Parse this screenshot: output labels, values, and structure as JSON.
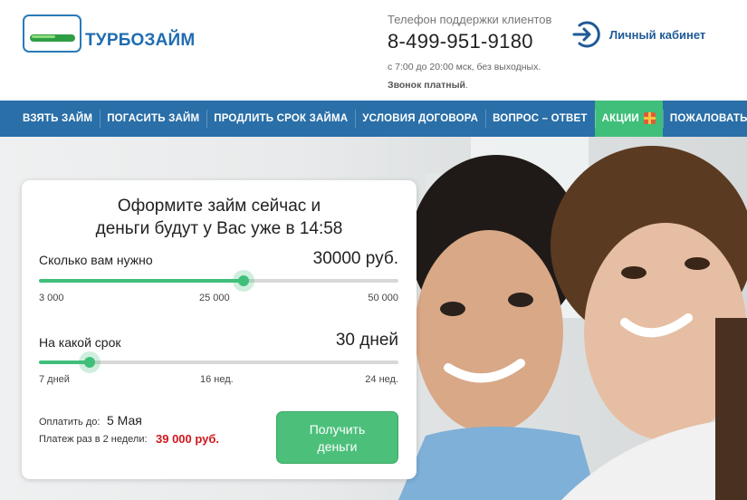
{
  "header": {
    "logo_text": "ТУРБОЗАЙМ",
    "support_label": "Телефон поддержки клиентов",
    "phone": "8-499-951-9180",
    "hours": "с 7:00 до 20:00 мск, без выходных.",
    "paid_strong": "Звонок платный",
    "paid_tail": ".",
    "account_label": "Личный кабинет",
    "account_icon": "login-arrow-icon"
  },
  "nav": {
    "items": [
      "ВЗЯТЬ ЗАЙМ",
      "ПОГАСИТЬ ЗАЙМ",
      "ПРОДЛИТЬ СРОК ЗАЙМА",
      "УСЛОВИЯ ДОГОВОРА",
      "ВОПРОС – ОТВЕТ",
      "АКЦИИ",
      "ПОЖАЛОВАТЬСЯ"
    ],
    "promo_icon": "gift-icon"
  },
  "form": {
    "title_line1": "Оформите займ сейчас и",
    "title_line2": "деньги будут у Вас уже в 14:58",
    "amount": {
      "label": "Сколько вам нужно",
      "value": "30000 руб.",
      "min_label": "3 000",
      "mid_label": "25 000",
      "max_label": "50 000",
      "fraction": 0.57
    },
    "term": {
      "label": "На какой срок",
      "value": "30 дней",
      "min_label": "7 дней",
      "mid_label": "16 нед.",
      "max_label": "24 нед.",
      "fraction": 0.14
    },
    "due_label": "Оплатить до:",
    "due_date": "5 Мая",
    "payment_label": "Платеж раз в 2 недели:",
    "payment_value": "39 000 руб.",
    "submit_line1": "Получить",
    "submit_line2": "деньги"
  },
  "colors": {
    "brand_blue": "#2a6fa8",
    "accent_green": "#3fbf7a",
    "price_red": "#d0171c"
  }
}
